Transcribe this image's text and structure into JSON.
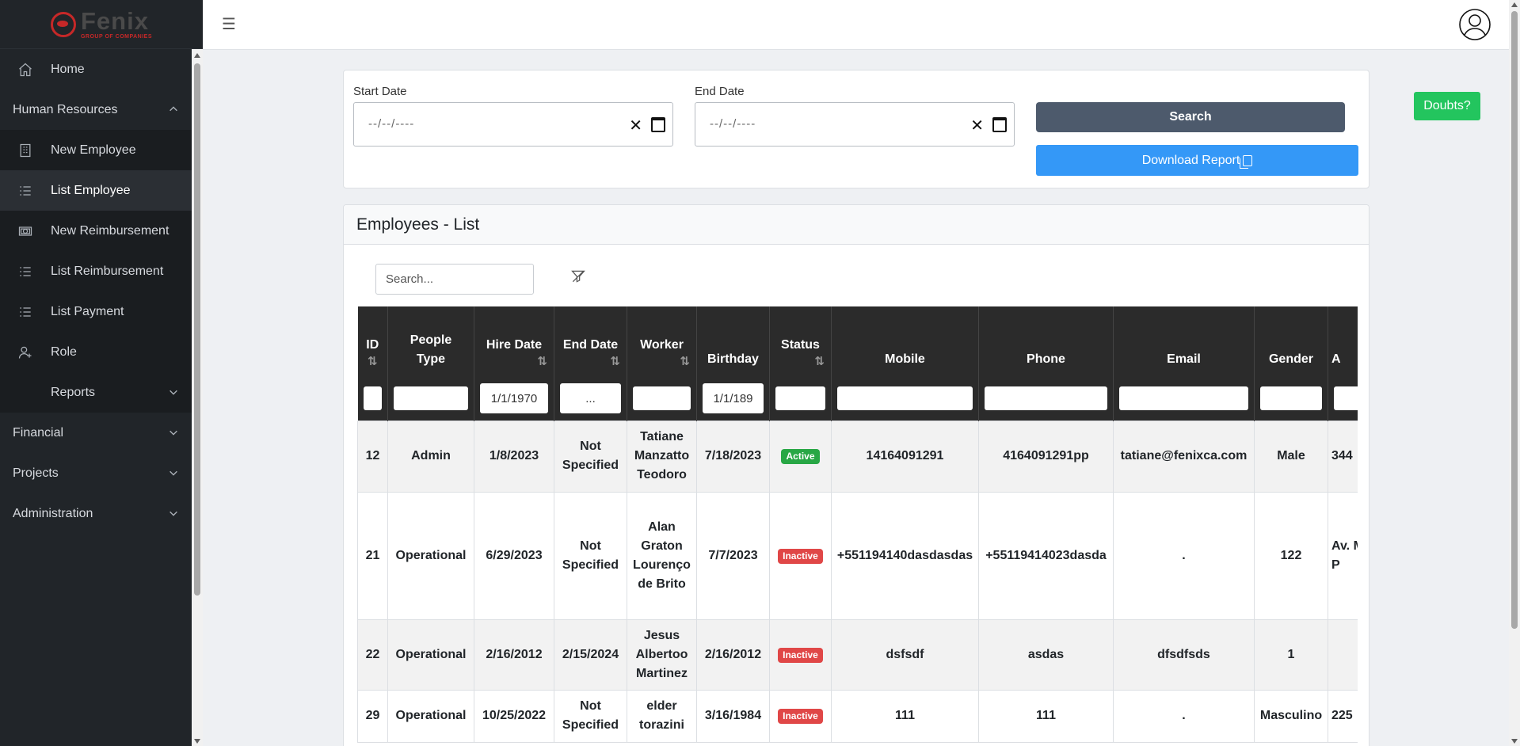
{
  "logo": {
    "name": "Fenix",
    "subtitle": "GROUP OF COMPANIES"
  },
  "sidebar": {
    "items": [
      {
        "label": "Home",
        "icon": "home-icon"
      },
      {
        "label": "Human Resources",
        "expanded": true
      },
      {
        "label": "New Employee",
        "icon": "building-icon"
      },
      {
        "label": "List Employee",
        "icon": "list-icon",
        "active": true
      },
      {
        "label": "New Reimbursement",
        "icon": "money-icon"
      },
      {
        "label": "List Reimbursement",
        "icon": "list-icon"
      },
      {
        "label": "List Payment",
        "icon": "list-icon"
      },
      {
        "label": "Role",
        "icon": "user-plus-icon"
      },
      {
        "label": "Reports"
      },
      {
        "label": "Financial"
      },
      {
        "label": "Projects"
      },
      {
        "label": "Administration"
      }
    ]
  },
  "topbar": {
    "menu_icon": "☰",
    "avatar_icon": "user-circle-icon"
  },
  "filters": {
    "start_label": "Start Date",
    "end_label": "End Date",
    "date_placeholder": "--/--/----",
    "clear_glyph": "✕",
    "search_label": "Search",
    "download_label": "Download Report"
  },
  "doubts_label": "Doubts?",
  "list": {
    "title": "Employees - List",
    "search_placeholder": "Search...",
    "columns": {
      "id": "ID",
      "people_type_1": "People",
      "people_type_2": "Type",
      "hire_date": "Hire Date",
      "end_date": "End Date",
      "worker": "Worker",
      "birthday": "Birthday",
      "status": "Status",
      "mobile": "Mobile",
      "phone": "Phone",
      "email": "Email",
      "gender": "Gender",
      "address": "A"
    },
    "sort_glyph": "⇅",
    "column_filters": {
      "hire_date": "1/1/1970",
      "end_date": "...",
      "birthday": "1/1/189"
    },
    "rows": [
      {
        "id": "12",
        "people_type": "Admin",
        "hire_date": "1/8/2023",
        "end_date": "Not Specified",
        "worker": "Tatiane Manzatto Teodoro",
        "birthday": "7/18/2023",
        "status": "Active",
        "mobile": "14164091291",
        "phone": "4164091291pp",
        "email": "tatiane@fenixca.com",
        "gender": "Male",
        "address": "344"
      },
      {
        "id": "21",
        "people_type": "Operational",
        "hire_date": "6/29/2023",
        "end_date": "Not Specified",
        "worker": "Alan Graton Lourenço de Brito",
        "birthday": "7/7/2023",
        "status": "Inactive",
        "mobile": "+551194140dasdasdas",
        "phone": "+55119414023dasda",
        "email": ".",
        "gender": "122",
        "address": "Av. M Alm Neig P"
      },
      {
        "id": "22",
        "people_type": "Operational",
        "hire_date": "2/16/2012",
        "end_date": "2/15/2024",
        "worker": "Jesus Albertoo Martinez",
        "birthday": "2/16/2012",
        "status": "Inactive",
        "mobile": "dsfsdf",
        "phone": "asdas",
        "email": "dfsdfsds",
        "gender": "1",
        "address": ""
      },
      {
        "id": "29",
        "people_type": "Operational",
        "hire_date": "10/25/2022",
        "end_date": "Not Specified",
        "worker": "elder torazini",
        "birthday": "3/16/1984",
        "status": "Inactive",
        "mobile": "111",
        "phone": "111",
        "email": ".",
        "gender": "Masculino",
        "address": "225"
      }
    ]
  },
  "colors": {
    "sidebar": "#212529",
    "search_button": "#4d5a6c",
    "download_button": "#3498f7",
    "doubts_button": "#23c55e",
    "active_badge": "#28a745",
    "inactive_badge": "#e04747",
    "table_header": "#2b2b2b"
  }
}
